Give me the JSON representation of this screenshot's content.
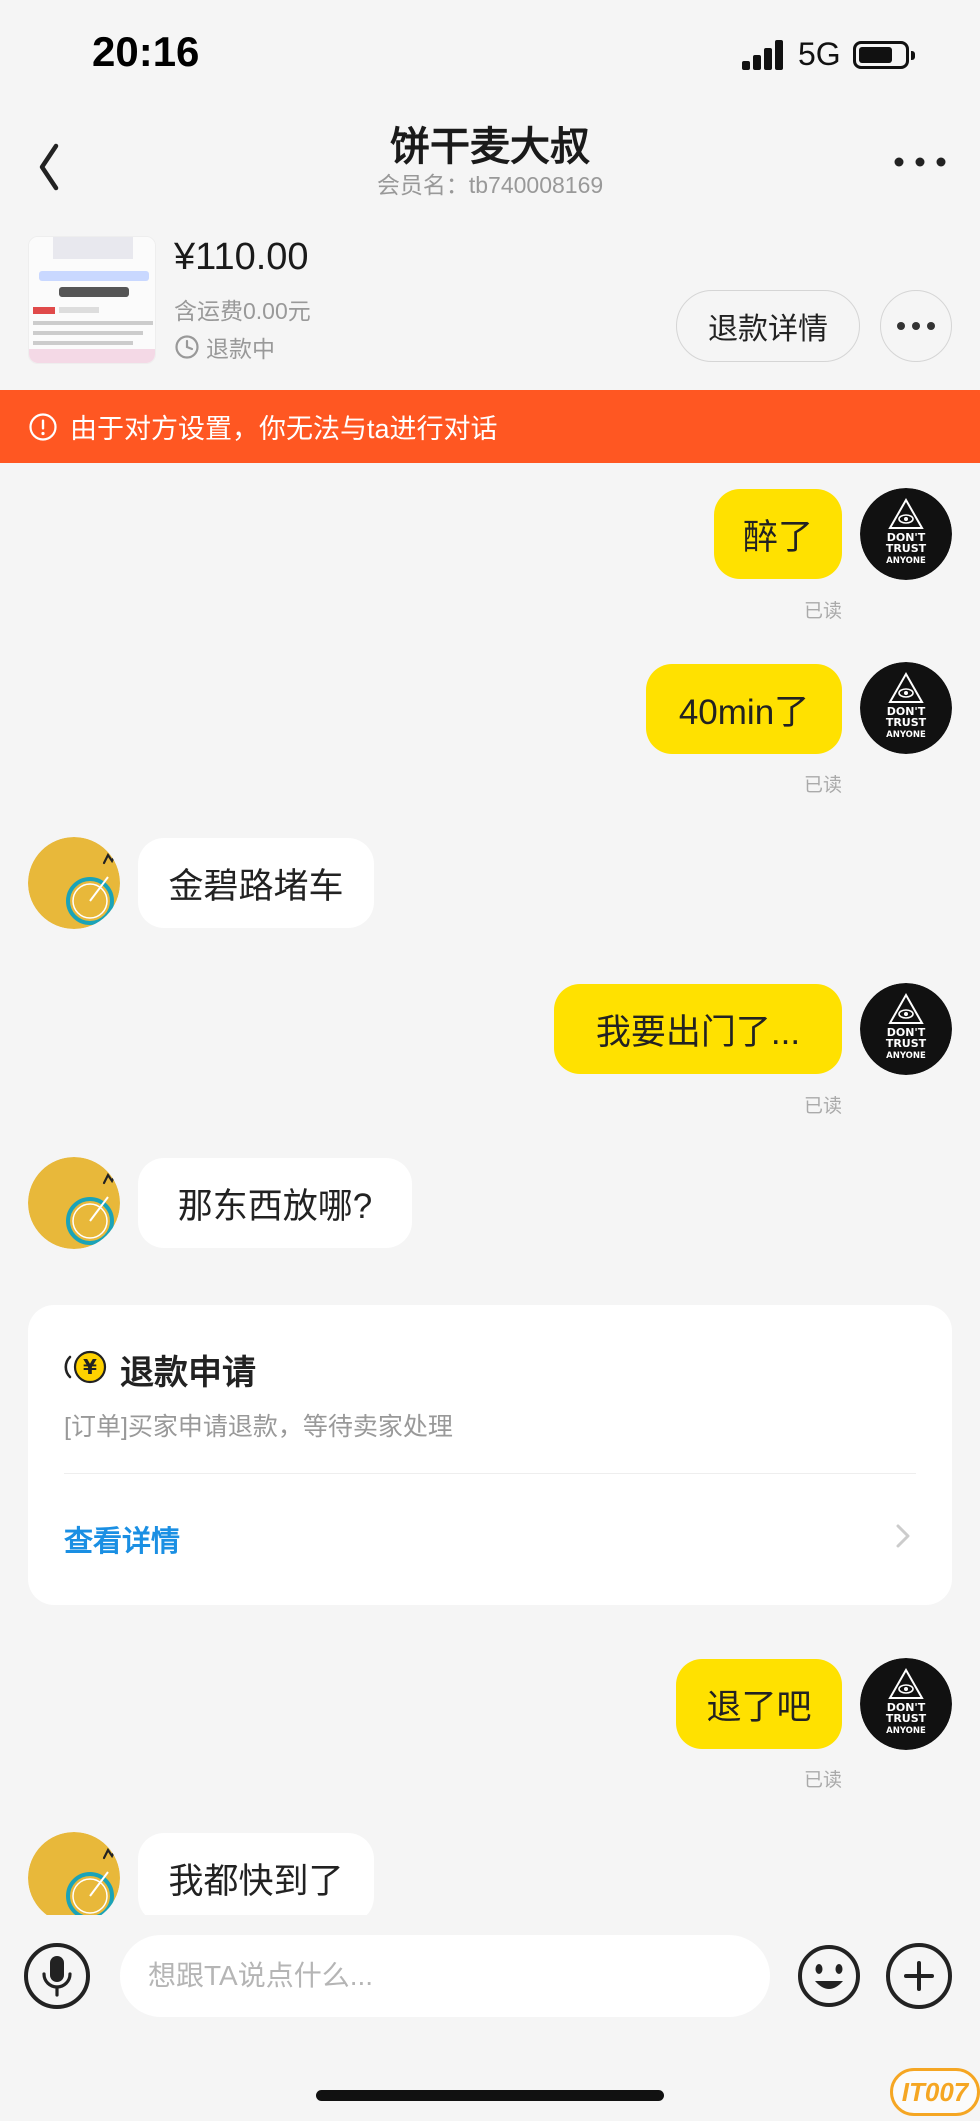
{
  "status_bar": {
    "time": "20:16",
    "network": "5G",
    "battery_level": 0.75
  },
  "nav": {
    "title": "饼干麦大叔",
    "subtitle": "会员名：tb740008169"
  },
  "product": {
    "price": "¥110.00",
    "shipping": "含运费0.00元",
    "refund_status": "退款中",
    "refund_detail_label": "退款详情"
  },
  "notice": {
    "text": "由于对方设置，你无法与ta进行对话"
  },
  "messages": [
    {
      "side": "me",
      "text": "醉了",
      "read": "已读"
    },
    {
      "side": "me",
      "text": "40min了",
      "read": "已读"
    },
    {
      "side": "other",
      "text": "金碧路堵车"
    },
    {
      "side": "me",
      "text": "我要出门了...",
      "read": "已读"
    },
    {
      "side": "other",
      "text": "那东西放哪?"
    },
    {
      "side": "me",
      "text": "退了吧",
      "read": "已读"
    },
    {
      "side": "other",
      "text": "我都快到了"
    }
  ],
  "refund_card": {
    "title": "退款申请",
    "description": "[订单]买家申请退款，等待卖家处理",
    "link_label": "查看详情"
  },
  "my_avatar": {
    "lines": [
      "DON'T",
      "TRUST",
      "ANYONE"
    ]
  },
  "input": {
    "placeholder": "想跟TA说点什么..."
  },
  "watermark": "IT007",
  "colors": {
    "accent_yellow": "#ffe100",
    "notice_orange": "#ff5722",
    "link_blue": "#1a8fe3"
  }
}
